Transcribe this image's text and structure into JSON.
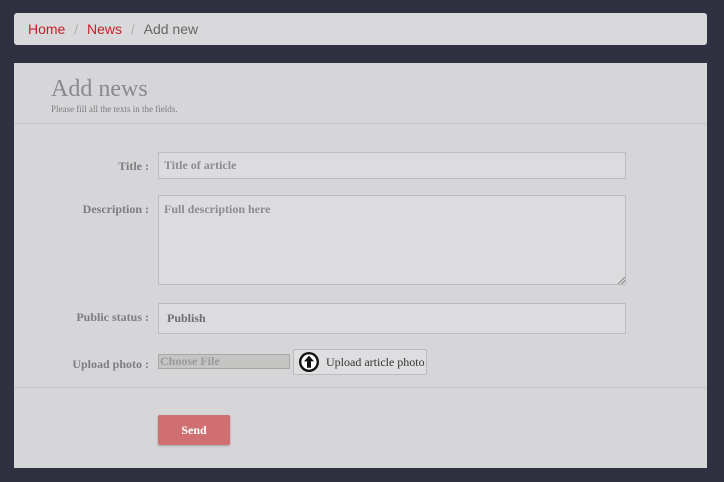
{
  "breadcrumb": {
    "home": "Home",
    "news": "News",
    "separator": "/",
    "current": "Add new"
  },
  "page": {
    "title": "Add news",
    "subtitle": "Please fill all the texts in the fields."
  },
  "form": {
    "title_label": "Title :",
    "title_placeholder": "Title of article",
    "title_value": "",
    "description_label": "Description :",
    "description_placeholder": "Full description here",
    "description_value": "",
    "status_label": "Public status :",
    "status_value": "Publish",
    "upload_label": "Upload photo :",
    "file_input_text": "Choose File",
    "upload_button": "Upload article photo",
    "upload_icon": "arrow-up-circle-icon",
    "send_button": "Send"
  },
  "colors": {
    "link": "#c8202a",
    "send": "#cf6f72",
    "background": "#2f3140",
    "panel": "#d6d6d8"
  }
}
